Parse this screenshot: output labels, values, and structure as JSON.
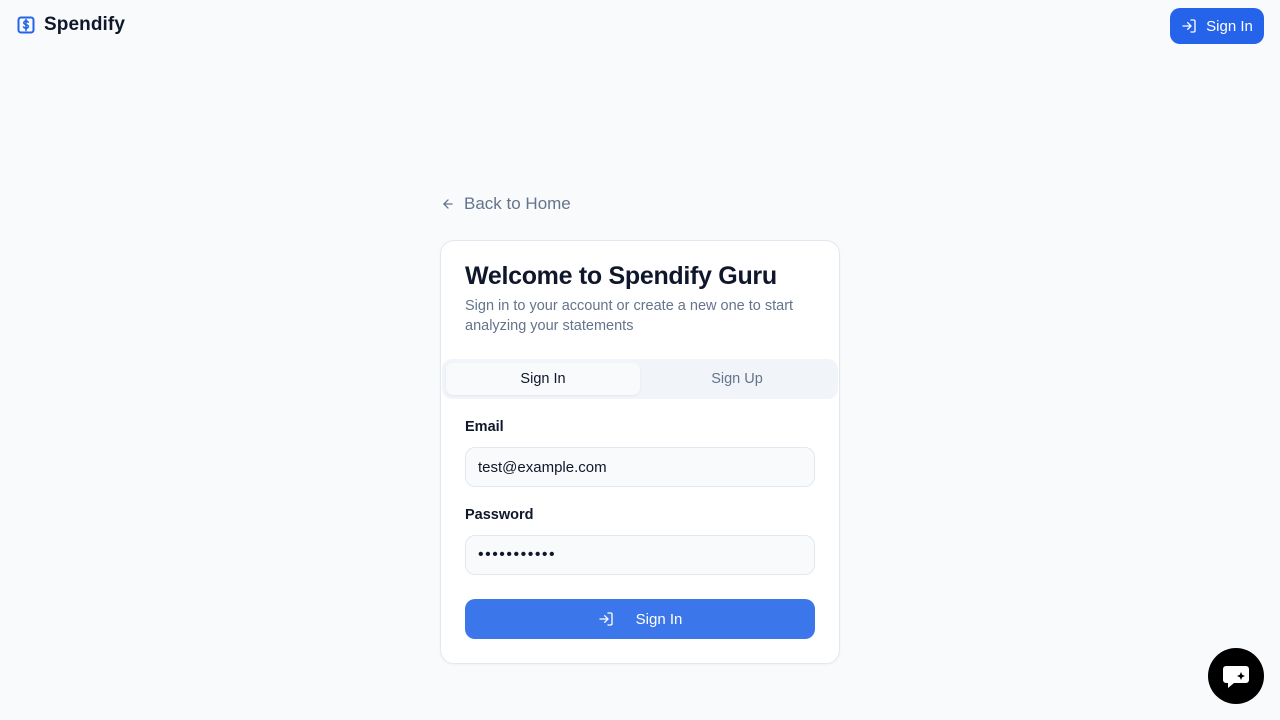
{
  "header": {
    "brand_name": "Spendify",
    "brand_icon": "dollar-square-icon",
    "signin_label": "Sign In",
    "signin_icon": "log-in-icon"
  },
  "back_link": {
    "label": "Back to Home",
    "icon": "arrow-left-icon"
  },
  "card": {
    "title": "Welcome to Spendify Guru",
    "subtitle": "Sign in to your account or create a new one to start analyzing your statements",
    "tabs": [
      {
        "label": "Sign In",
        "active": true
      },
      {
        "label": "Sign Up",
        "active": false
      }
    ],
    "email": {
      "label": "Email",
      "value": "test@example.com"
    },
    "password": {
      "label": "Password",
      "value": "password123"
    },
    "submit_label": "Sign In",
    "submit_icon": "log-in-icon"
  },
  "chat_fab": {
    "icon": "chat-sparkle-icon"
  },
  "colors": {
    "background": "#f8fafc",
    "primary": "#2563eb",
    "submit": "#3b76ea",
    "text": "#0f172a",
    "muted": "#64748b"
  }
}
